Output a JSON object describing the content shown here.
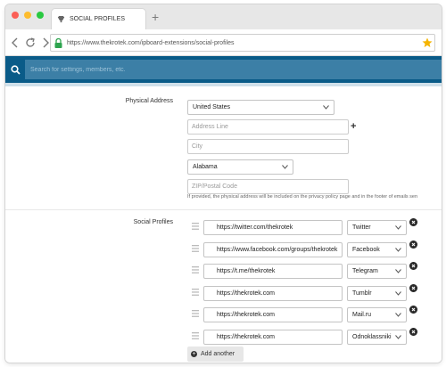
{
  "browser": {
    "tab_title": "SOCIAL PROFILES",
    "url": "https://www.thekrotek.com/ipboard-extensions/social-profiles"
  },
  "search": {
    "placeholder": "Search for settings, members, etc."
  },
  "address": {
    "label": "Physical Address",
    "country": "United States",
    "address_line_placeholder": "Address Line",
    "city_placeholder": "City",
    "state": "Alabama",
    "zip_placeholder": "ZIP/Postal Code",
    "help": "If provided, the physical address will be included on the privacy policy page and in the footer of emails sen"
  },
  "social": {
    "label": "Social Profiles",
    "profiles": [
      {
        "url": "https://twitter.com/thekrotek",
        "service": "Twitter"
      },
      {
        "url": "https://www.facebook.com/groups/thekrotek",
        "service": "Facebook"
      },
      {
        "url": "https://t.me/thekrotek",
        "service": "Telegram"
      },
      {
        "url": "https://thekrotek.com",
        "service": "Tumblr"
      },
      {
        "url": "https://thekrotek.com",
        "service": "Mail.ru"
      },
      {
        "url": "https://thekrotek.com",
        "service": "Odnoklassniki"
      }
    ],
    "add_label": "Add another"
  },
  "colors": {
    "header": "#0a5b88",
    "search_bg": "#3c7fa6",
    "star": "#f5b400",
    "lock": "#2ea44f"
  }
}
